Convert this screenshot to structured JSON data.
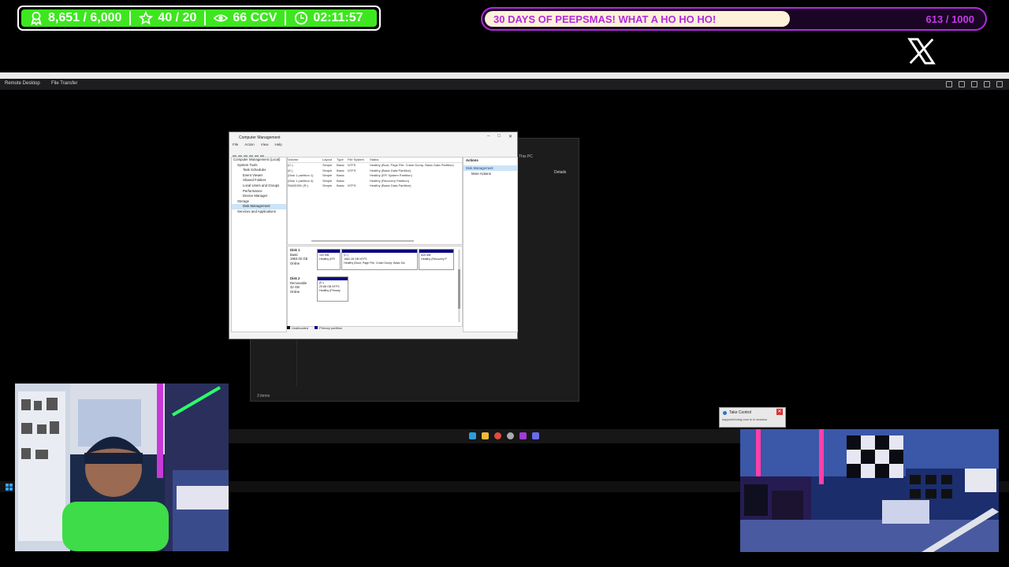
{
  "stats": {
    "followers": "8,651 / 6,000",
    "subs": "40 / 20",
    "viewers": "66 CCV",
    "uptime": "02:11:57",
    "accent_color": "#3ee61f"
  },
  "goal": {
    "title": "30 DAYS OF PEEPSMAS! WHAT A HO HO HO!",
    "count": "613 / 1000",
    "progress": 0.613,
    "accent_color": "#b42adf"
  },
  "remote": {
    "tab_label": "",
    "menu": [
      "Remote Desktop",
      "File Transfer"
    ]
  },
  "explorer": {
    "title": "This PC",
    "details": "Details",
    "status": "3 items"
  },
  "cm": {
    "title": "Computer Management",
    "menu": [
      "File",
      "Action",
      "View",
      "Help"
    ],
    "tree": [
      "Computer Management (Local)",
      "System Tools",
      "Task Scheduler",
      "Event Viewer",
      "Shared Folders",
      "Local Users and Groups",
      "Performance",
      "Device Manager",
      "Storage",
      "Disk Management",
      "Services and Applications"
    ],
    "columns": [
      "Volume",
      "Layout",
      "Type",
      "File System",
      "Status"
    ],
    "rows": [
      [
        "(C:)",
        "Simple",
        "Basic",
        "NTFS",
        "Healthy (Boot, Page File, Crash Dump, Basic Data Partition)"
      ],
      [
        "(E:)",
        "Simple",
        "Basic",
        "NTFS",
        "Healthy (Basic Data Partition)"
      ],
      [
        "(Disk 1 partition 1)",
        "Simple",
        "Basic",
        "",
        "Healthy (EFI System Partition)"
      ],
      [
        "(Disk 1 partition 4)",
        "Simple",
        "Basic",
        "",
        "Healthy (Recovery Partition)"
      ],
      [
        "RAMDISK (R:)",
        "Simple",
        "Basic",
        "NTFS",
        "Healthy (Basic Data Partition)"
      ]
    ],
    "disks": [
      {
        "label": "Disk 1",
        "info": [
          "Basic",
          "1863.02 GB",
          "Online"
        ],
        "parts": [
          {
            "lines": [
              "100 MB",
              "Healthy (EFI"
            ]
          },
          {
            "lines": [
              "(C:)",
              "1862.28 GB NTFS",
              "Healthy (Boot, Page File, Crash Dump, Basic Da"
            ]
          },
          {
            "lines": [
              "645 MB",
              "Healthy (Recovery P"
            ]
          }
        ]
      },
      {
        "label": "Disk 2",
        "info": [
          "Removable",
          "32 GB",
          "Online"
        ],
        "parts": [
          {
            "lines": [
              "(E:)",
              "29.88 GB NTFS",
              "Healthy (Primary"
            ]
          }
        ]
      }
    ],
    "legend": [
      "Unallocated",
      "Primary partition"
    ],
    "actions": {
      "header": "Actions",
      "selected": "Disk Management",
      "more": "More Actions"
    }
  },
  "notification": {
    "title": "Take Control",
    "subtitle": "support/erving.com is in session"
  }
}
